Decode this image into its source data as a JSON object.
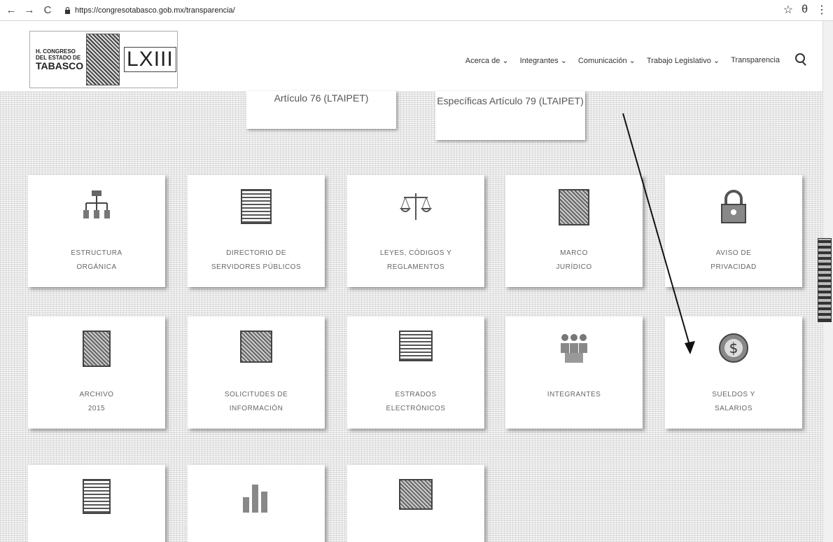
{
  "browser": {
    "url": "https://congresotabasco.gob.mx/transparencia/",
    "back_icon": "arrow-left",
    "forward_icon": "arrow-right",
    "reload_icon": "reload",
    "star_icon": "☆",
    "account_icon": "θ",
    "menu_icon": "⋮"
  },
  "header": {
    "logo": {
      "line1": "H. CONGRESO",
      "line2": "DEL ESTADO DE",
      "line3": "TABASCO",
      "roman": "LXIII"
    },
    "nav": [
      {
        "label": "Acerca de ⌄"
      },
      {
        "label": "Integrantes ⌄"
      },
      {
        "label": "Comunicación ⌄"
      },
      {
        "label": "Trabajo Legislativo ⌄"
      },
      {
        "label": "Transparencia"
      }
    ]
  },
  "top_cards": [
    {
      "label": "Artículo 76 (LTAIPET)"
    },
    {
      "label": "Específicas Artículo 79 (LTAIPET)"
    }
  ],
  "tiles": [
    {
      "line1": "ESTRUCTURA",
      "line2": "ORGÁNICA",
      "icon": "org-chart-icon"
    },
    {
      "line1": "DIRECTORIO DE",
      "line2": "SERVIDORES PÚBLICOS",
      "icon": "directory-icon"
    },
    {
      "line1": "LEYES, CÓDIGOS Y",
      "line2": "REGLAMENTOS",
      "icon": "scales-icon"
    },
    {
      "line1": "MARCO",
      "line2": "JURÍDICO",
      "icon": "book-icon"
    },
    {
      "line1": "AVISO DE",
      "line2": "PRIVACIDAD",
      "icon": "padlock-icon"
    },
    {
      "line1": "ARCHIVO",
      "line2": "2015",
      "icon": "archive-icon"
    },
    {
      "line1": "SOLICITUDES DE",
      "line2": "INFORMACIÓN",
      "icon": "request-icon"
    },
    {
      "line1": "ESTRADOS",
      "line2": "ELECTRÓNICOS",
      "icon": "board-icon"
    },
    {
      "line1": "INTEGRANTES",
      "line2": "",
      "icon": "people-icon"
    },
    {
      "line1": "SUELDOS Y",
      "line2": "SALARIOS",
      "icon": "money-icon"
    },
    {
      "line1": "",
      "line2": "",
      "icon": "calculator-icon"
    },
    {
      "line1": "",
      "line2": "",
      "icon": "bar-chart-icon"
    },
    {
      "line1": "",
      "line2": "",
      "icon": "cash-register-icon"
    }
  ]
}
